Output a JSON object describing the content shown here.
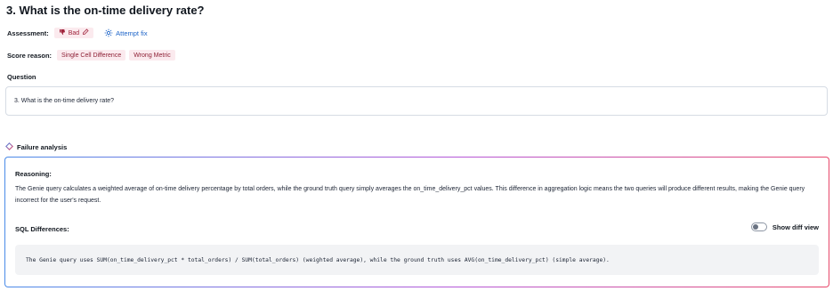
{
  "header": {
    "title": "3. What is the on-time delivery rate?"
  },
  "assessment": {
    "label": "Assessment:",
    "badge_text": "Bad",
    "fix_label": "Attempt fix",
    "accent_color": "#a0243c",
    "link_color": "#1d64c8"
  },
  "score_reason": {
    "label": "Score reason:",
    "tags": [
      "Single Cell Difference",
      "Wrong Metric"
    ]
  },
  "question": {
    "label": "Question",
    "text": "3. What is the on-time delivery rate?"
  },
  "failure_analysis": {
    "title": "Failure analysis",
    "reasoning_title": "Reasoning:",
    "reasoning_text": "The Genie query calculates a weighted average of on-time delivery percentage by total orders, while the ground truth query simply averages the on_time_delivery_pct values. This difference in aggregation logic means the two queries will produce different results, making the Genie query incorrect for the user's request.",
    "sql_title": "SQL Differences:",
    "toggle_label": "Show diff view",
    "toggle_on": false,
    "sql_text": "The Genie query uses SUM(on_time_delivery_pct * total_orders) / SUM(total_orders) (weighted average), while the ground truth uses AVG(on_time_delivery_pct) (simple average)."
  }
}
